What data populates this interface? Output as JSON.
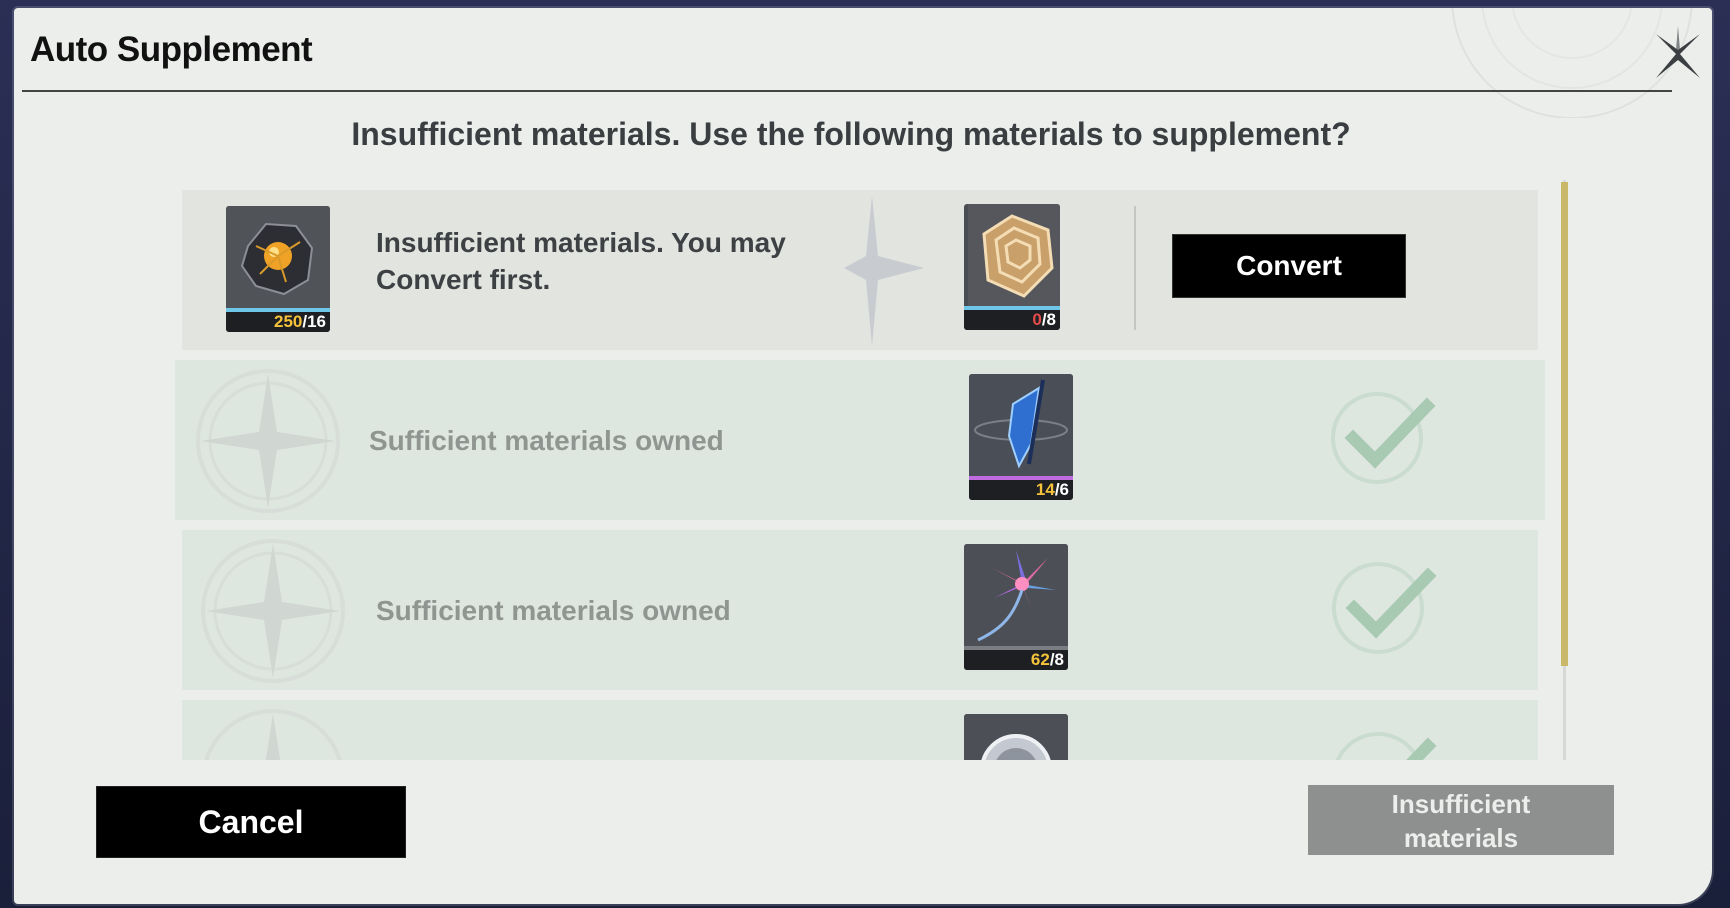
{
  "dialog": {
    "title": "Auto Supplement",
    "headline": "Insufficient materials. Use the following materials to supplement?"
  },
  "rows": [
    {
      "status": "insufficient",
      "message": "Insufficient materials. You may Convert first.",
      "source_item": {
        "icon": "metal-ore-icon",
        "owned": "250",
        "required": "/16"
      },
      "target_item": {
        "icon": "golden-spiral-shell-icon",
        "owned": "0",
        "required": "/8"
      },
      "action_label": "Convert"
    },
    {
      "status": "sufficient",
      "message": "Sufficient materials owned",
      "target_item": {
        "icon": "blue-crystal-spear-icon",
        "owned": "14",
        "required": "/6"
      }
    },
    {
      "status": "sufficient",
      "message": "Sufficient materials owned",
      "target_item": {
        "icon": "pink-flower-icon",
        "owned": "62",
        "required": "/8"
      }
    }
  ],
  "footer": {
    "cancel_label": "Cancel",
    "confirm_label_line1": "Insufficient",
    "confirm_label_line2": "materials"
  },
  "colors": {
    "accent_scroll": "#c9b86a",
    "owned_ok": "#f5c33b",
    "owned_low": "#e74c4c",
    "check_green": "#9fc4ab"
  }
}
